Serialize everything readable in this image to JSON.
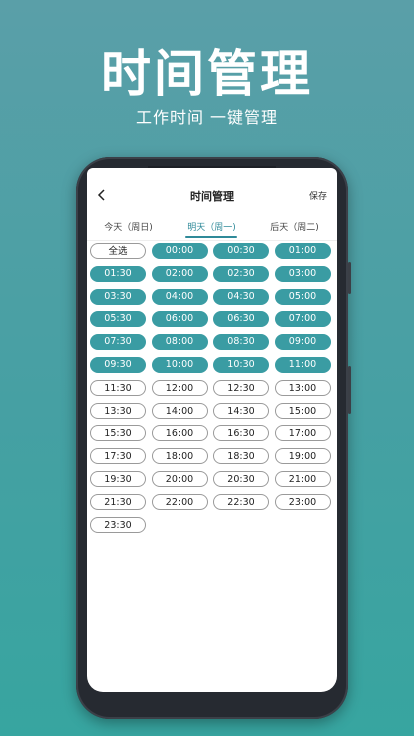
{
  "hero": {
    "title": "时间管理",
    "subtitle": "工作时间 一键管理"
  },
  "app": {
    "title": "时间管理",
    "save_label": "保存",
    "back_icon": "chevron-left-icon"
  },
  "tabs": [
    {
      "label": "今天（周日)",
      "active": false
    },
    {
      "label": "明天（周一)",
      "active": true
    },
    {
      "label": "后天（周二)",
      "active": false
    }
  ],
  "colors": {
    "accent": "#3a9ca3",
    "background_top": "#5a9fa8",
    "background_bottom": "#37a5a0"
  },
  "select_all": {
    "label": "全选",
    "selected": false
  },
  "slots": [
    {
      "time": "00:00",
      "selected": true
    },
    {
      "time": "00:30",
      "selected": true
    },
    {
      "time": "01:00",
      "selected": true
    },
    {
      "time": "01:30",
      "selected": true
    },
    {
      "time": "02:00",
      "selected": true
    },
    {
      "time": "02:30",
      "selected": true
    },
    {
      "time": "03:00",
      "selected": true
    },
    {
      "time": "03:30",
      "selected": true
    },
    {
      "time": "04:00",
      "selected": true
    },
    {
      "time": "04:30",
      "selected": true
    },
    {
      "time": "05:00",
      "selected": true
    },
    {
      "time": "05:30",
      "selected": true
    },
    {
      "time": "06:00",
      "selected": true
    },
    {
      "time": "06:30",
      "selected": true
    },
    {
      "time": "07:00",
      "selected": true
    },
    {
      "time": "07:30",
      "selected": true
    },
    {
      "time": "08:00",
      "selected": true
    },
    {
      "time": "08:30",
      "selected": true
    },
    {
      "time": "09:00",
      "selected": true
    },
    {
      "time": "09:30",
      "selected": true
    },
    {
      "time": "10:00",
      "selected": true
    },
    {
      "time": "10:30",
      "selected": true
    },
    {
      "time": "11:00",
      "selected": true
    },
    {
      "time": "11:30",
      "selected": false
    },
    {
      "time": "12:00",
      "selected": false
    },
    {
      "time": "12:30",
      "selected": false
    },
    {
      "time": "13:00",
      "selected": false
    },
    {
      "time": "13:30",
      "selected": false
    },
    {
      "time": "14:00",
      "selected": false
    },
    {
      "time": "14:30",
      "selected": false
    },
    {
      "time": "15:00",
      "selected": false
    },
    {
      "time": "15:30",
      "selected": false
    },
    {
      "time": "16:00",
      "selected": false
    },
    {
      "time": "16:30",
      "selected": false
    },
    {
      "time": "17:00",
      "selected": false
    },
    {
      "time": "17:30",
      "selected": false
    },
    {
      "time": "18:00",
      "selected": false
    },
    {
      "time": "18:30",
      "selected": false
    },
    {
      "time": "19:00",
      "selected": false
    },
    {
      "time": "19:30",
      "selected": false
    },
    {
      "time": "20:00",
      "selected": false
    },
    {
      "time": "20:30",
      "selected": false
    },
    {
      "time": "21:00",
      "selected": false
    },
    {
      "time": "21:30",
      "selected": false
    },
    {
      "time": "22:00",
      "selected": false
    },
    {
      "time": "22:30",
      "selected": false
    },
    {
      "time": "23:00",
      "selected": false
    },
    {
      "time": "23:30",
      "selected": false
    }
  ]
}
